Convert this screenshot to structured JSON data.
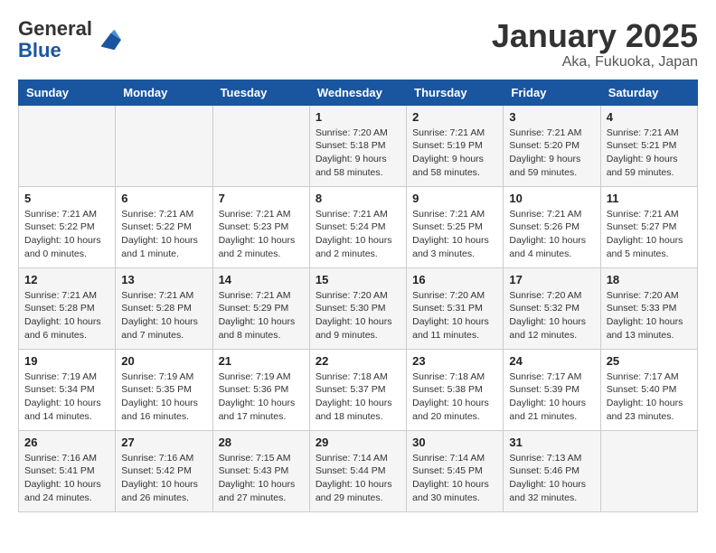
{
  "header": {
    "logo_general": "General",
    "logo_blue": "Blue",
    "month": "January 2025",
    "location": "Aka, Fukuoka, Japan"
  },
  "weekdays": [
    "Sunday",
    "Monday",
    "Tuesday",
    "Wednesday",
    "Thursday",
    "Friday",
    "Saturday"
  ],
  "weeks": [
    [
      {
        "day": "",
        "info": ""
      },
      {
        "day": "",
        "info": ""
      },
      {
        "day": "",
        "info": ""
      },
      {
        "day": "1",
        "info": "Sunrise: 7:20 AM\nSunset: 5:18 PM\nDaylight: 9 hours\nand 58 minutes."
      },
      {
        "day": "2",
        "info": "Sunrise: 7:21 AM\nSunset: 5:19 PM\nDaylight: 9 hours\nand 58 minutes."
      },
      {
        "day": "3",
        "info": "Sunrise: 7:21 AM\nSunset: 5:20 PM\nDaylight: 9 hours\nand 59 minutes."
      },
      {
        "day": "4",
        "info": "Sunrise: 7:21 AM\nSunset: 5:21 PM\nDaylight: 9 hours\nand 59 minutes."
      }
    ],
    [
      {
        "day": "5",
        "info": "Sunrise: 7:21 AM\nSunset: 5:22 PM\nDaylight: 10 hours\nand 0 minutes."
      },
      {
        "day": "6",
        "info": "Sunrise: 7:21 AM\nSunset: 5:22 PM\nDaylight: 10 hours\nand 1 minute."
      },
      {
        "day": "7",
        "info": "Sunrise: 7:21 AM\nSunset: 5:23 PM\nDaylight: 10 hours\nand 2 minutes."
      },
      {
        "day": "8",
        "info": "Sunrise: 7:21 AM\nSunset: 5:24 PM\nDaylight: 10 hours\nand 2 minutes."
      },
      {
        "day": "9",
        "info": "Sunrise: 7:21 AM\nSunset: 5:25 PM\nDaylight: 10 hours\nand 3 minutes."
      },
      {
        "day": "10",
        "info": "Sunrise: 7:21 AM\nSunset: 5:26 PM\nDaylight: 10 hours\nand 4 minutes."
      },
      {
        "day": "11",
        "info": "Sunrise: 7:21 AM\nSunset: 5:27 PM\nDaylight: 10 hours\nand 5 minutes."
      }
    ],
    [
      {
        "day": "12",
        "info": "Sunrise: 7:21 AM\nSunset: 5:28 PM\nDaylight: 10 hours\nand 6 minutes."
      },
      {
        "day": "13",
        "info": "Sunrise: 7:21 AM\nSunset: 5:28 PM\nDaylight: 10 hours\nand 7 minutes."
      },
      {
        "day": "14",
        "info": "Sunrise: 7:21 AM\nSunset: 5:29 PM\nDaylight: 10 hours\nand 8 minutes."
      },
      {
        "day": "15",
        "info": "Sunrise: 7:20 AM\nSunset: 5:30 PM\nDaylight: 10 hours\nand 9 minutes."
      },
      {
        "day": "16",
        "info": "Sunrise: 7:20 AM\nSunset: 5:31 PM\nDaylight: 10 hours\nand 11 minutes."
      },
      {
        "day": "17",
        "info": "Sunrise: 7:20 AM\nSunset: 5:32 PM\nDaylight: 10 hours\nand 12 minutes."
      },
      {
        "day": "18",
        "info": "Sunrise: 7:20 AM\nSunset: 5:33 PM\nDaylight: 10 hours\nand 13 minutes."
      }
    ],
    [
      {
        "day": "19",
        "info": "Sunrise: 7:19 AM\nSunset: 5:34 PM\nDaylight: 10 hours\nand 14 minutes."
      },
      {
        "day": "20",
        "info": "Sunrise: 7:19 AM\nSunset: 5:35 PM\nDaylight: 10 hours\nand 16 minutes."
      },
      {
        "day": "21",
        "info": "Sunrise: 7:19 AM\nSunset: 5:36 PM\nDaylight: 10 hours\nand 17 minutes."
      },
      {
        "day": "22",
        "info": "Sunrise: 7:18 AM\nSunset: 5:37 PM\nDaylight: 10 hours\nand 18 minutes."
      },
      {
        "day": "23",
        "info": "Sunrise: 7:18 AM\nSunset: 5:38 PM\nDaylight: 10 hours\nand 20 minutes."
      },
      {
        "day": "24",
        "info": "Sunrise: 7:17 AM\nSunset: 5:39 PM\nDaylight: 10 hours\nand 21 minutes."
      },
      {
        "day": "25",
        "info": "Sunrise: 7:17 AM\nSunset: 5:40 PM\nDaylight: 10 hours\nand 23 minutes."
      }
    ],
    [
      {
        "day": "26",
        "info": "Sunrise: 7:16 AM\nSunset: 5:41 PM\nDaylight: 10 hours\nand 24 minutes."
      },
      {
        "day": "27",
        "info": "Sunrise: 7:16 AM\nSunset: 5:42 PM\nDaylight: 10 hours\nand 26 minutes."
      },
      {
        "day": "28",
        "info": "Sunrise: 7:15 AM\nSunset: 5:43 PM\nDaylight: 10 hours\nand 27 minutes."
      },
      {
        "day": "29",
        "info": "Sunrise: 7:14 AM\nSunset: 5:44 PM\nDaylight: 10 hours\nand 29 minutes."
      },
      {
        "day": "30",
        "info": "Sunrise: 7:14 AM\nSunset: 5:45 PM\nDaylight: 10 hours\nand 30 minutes."
      },
      {
        "day": "31",
        "info": "Sunrise: 7:13 AM\nSunset: 5:46 PM\nDaylight: 10 hours\nand 32 minutes."
      },
      {
        "day": "",
        "info": ""
      }
    ]
  ]
}
